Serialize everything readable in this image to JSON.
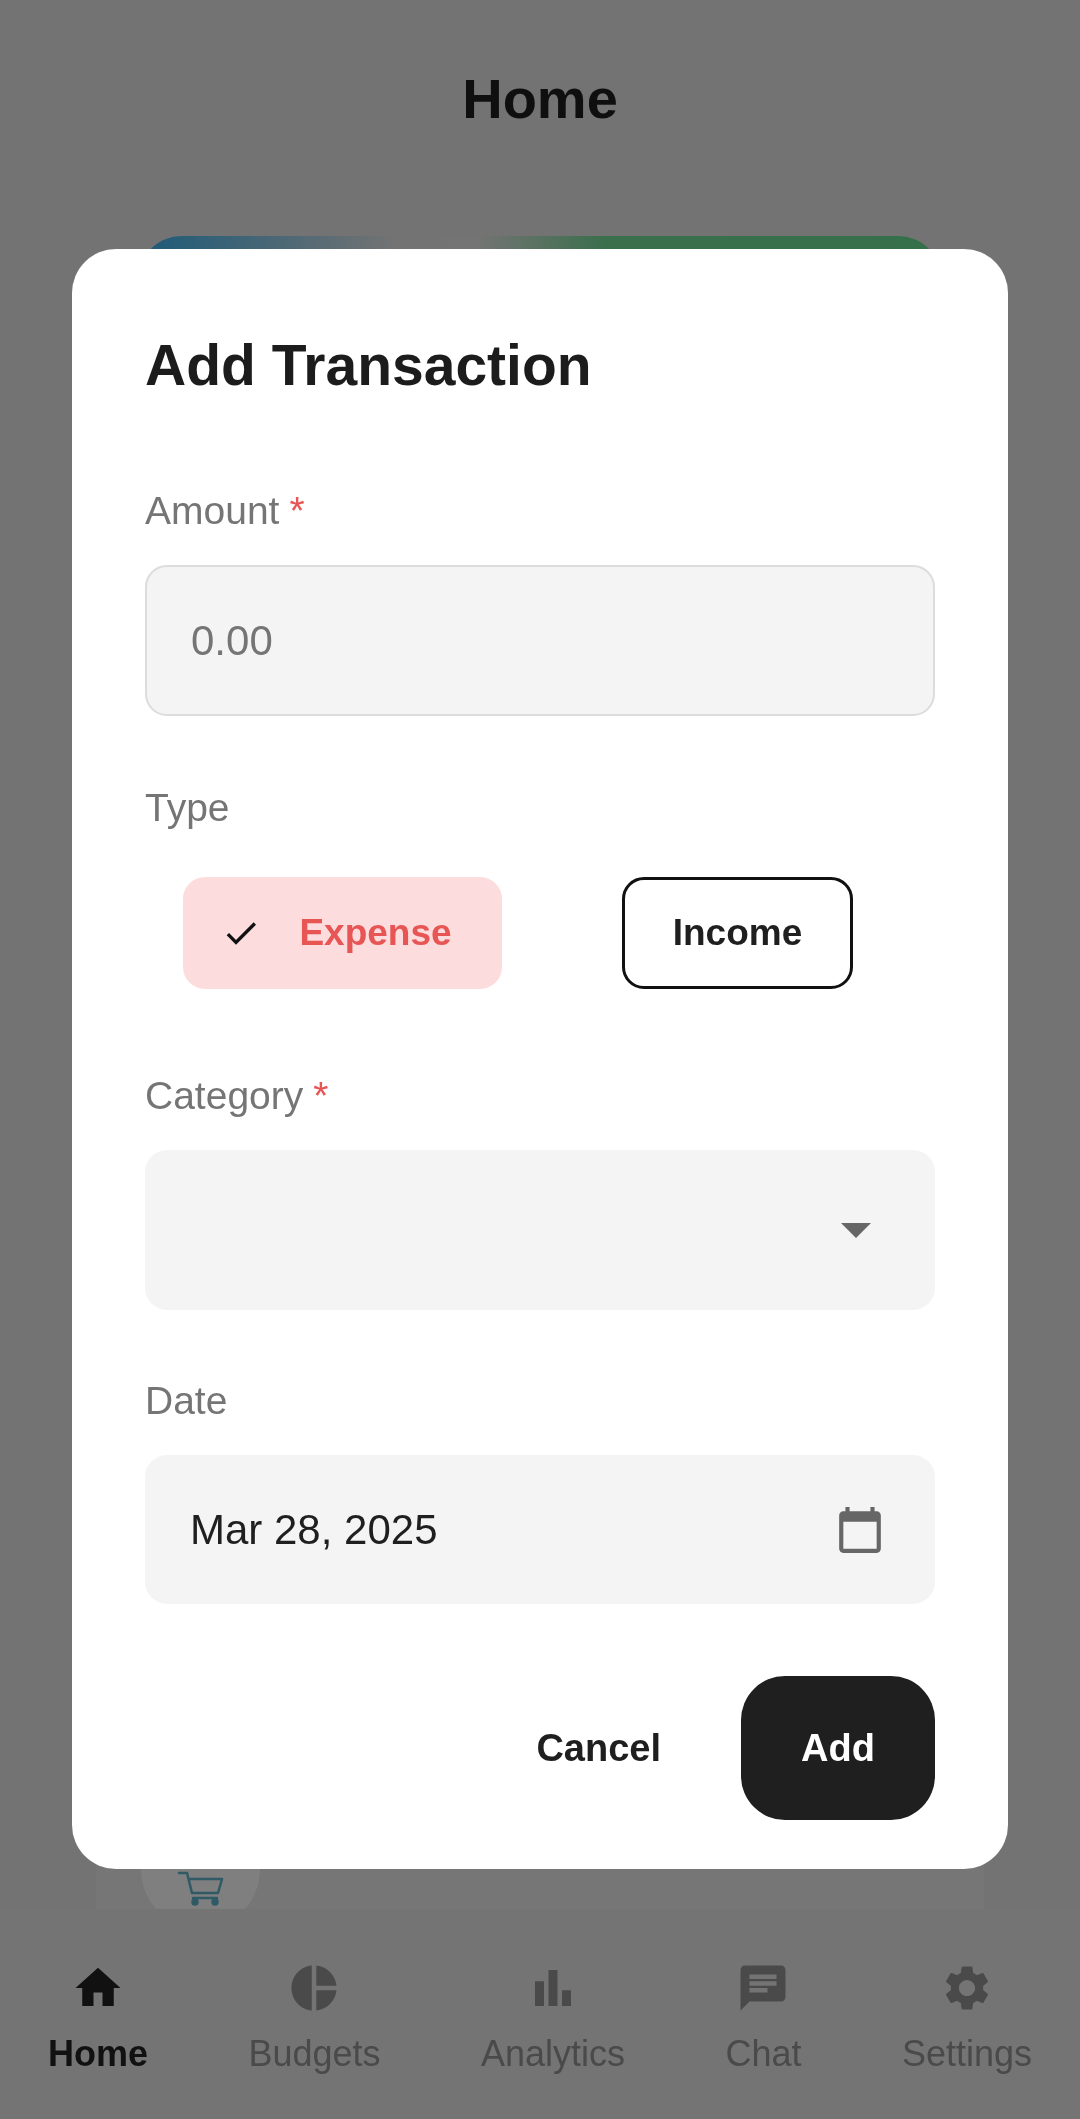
{
  "app_bar": {
    "title": "Home"
  },
  "dialog": {
    "title": "Add Transaction",
    "fields": [
      {
        "kind": "text",
        "label": "Amount",
        "required_mark": "*",
        "placeholder": "0.00"
      },
      {
        "kind": "choice",
        "label": "Type",
        "options": [
          {
            "label": "Expense",
            "selected": true
          },
          {
            "label": "Income",
            "selected": false
          }
        ]
      },
      {
        "kind": "dropdown",
        "label": "Category",
        "required_mark": "*"
      },
      {
        "kind": "date",
        "label": "Date",
        "value": "Mar 28, 2025"
      }
    ],
    "actions": [
      {
        "kind": "text",
        "label": "Cancel"
      },
      {
        "kind": "filled",
        "label": "Add"
      }
    ]
  },
  "nav": [
    {
      "label": "Home",
      "selected": true
    },
    {
      "label": "Budgets",
      "selected": false
    },
    {
      "label": "Analytics",
      "selected": false
    },
    {
      "label": "Chat",
      "selected": false
    },
    {
      "label": "Settings",
      "selected": false
    }
  ]
}
